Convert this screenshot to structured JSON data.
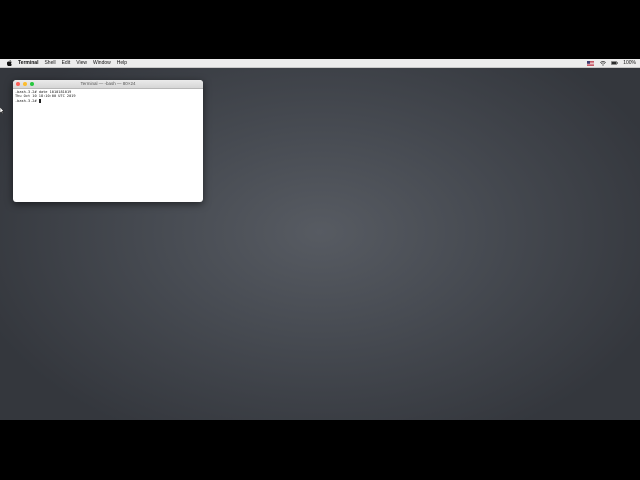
{
  "menubar": {
    "app_name": "Terminal",
    "items": [
      {
        "label": "Shell"
      },
      {
        "label": "Edit"
      },
      {
        "label": "View"
      },
      {
        "label": "Window"
      },
      {
        "label": "Help"
      }
    ],
    "status": {
      "flag_icon": "us-flag-icon",
      "wifi_icon": "wifi-icon",
      "battery_icon": "battery-icon",
      "battery_percent": "100%"
    }
  },
  "terminal": {
    "title": "Terminal — -bash — 80×24",
    "lines": [
      {
        "prompt": "-bash-3.2# ",
        "text": "date 1010181019"
      },
      {
        "prompt": "",
        "text": "Thu Oct 10 18:10:00 UTC 2019"
      },
      {
        "prompt": "-bash-3.2# ",
        "text": ""
      }
    ]
  },
  "colors": {
    "desktop_center": "#575b62",
    "desktop_edge": "#34373d",
    "close": "#fc5f57",
    "minimize": "#fdbd2e",
    "maximize": "#28c840"
  }
}
